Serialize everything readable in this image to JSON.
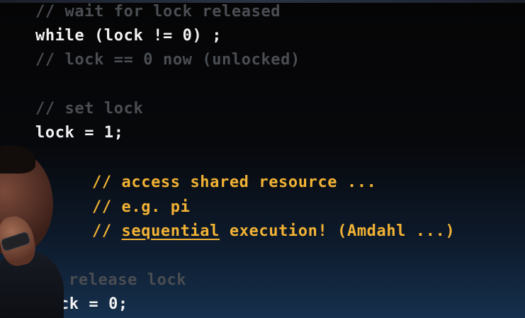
{
  "slide": {
    "lines": [
      {
        "text": "// wait for lock released",
        "kind": "comment"
      },
      {
        "text": "while (lock != 0) ;",
        "kind": "code"
      },
      {
        "text": "// lock == 0 now (unlocked)",
        "kind": "comment"
      },
      {
        "text": "// set lock",
        "kind": "comment"
      },
      {
        "text": "lock = 1;",
        "kind": "code"
      },
      {
        "text": "// access shared resource ...",
        "kind": "yellow"
      },
      {
        "text": "// e.g. pi",
        "kind": "yellow"
      },
      {
        "text_prefix": "// ",
        "text_underlined": "sequential",
        "text_suffix": " execution! (Amdahl ...)",
        "kind": "yellow"
      },
      {
        "text": "release lock",
        "kind": "comment",
        "partially_hidden": true
      },
      {
        "text": "ock = 0;",
        "kind": "code",
        "partially_hidden": true
      }
    ]
  },
  "colors": {
    "comment": "#4a4d52",
    "code": "#f2f2f2",
    "highlight": "#f2b234",
    "background_top": "#050506",
    "background_bottom": "#16304d"
  }
}
